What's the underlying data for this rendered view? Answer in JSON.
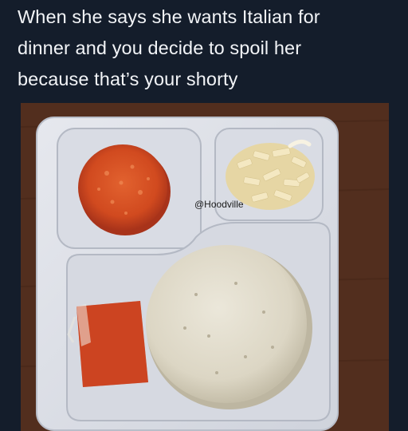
{
  "post": {
    "caption_lines": [
      "When she says she wants Italian for",
      "dinner and you decide to spoil her",
      "because that’s your shorty"
    ]
  },
  "photo": {
    "watermark": "@Hoodville",
    "colors": {
      "background": "#141d2b",
      "caption_text": "#f2f4f7",
      "table_wood": "#4a2a1c",
      "tray": "#dcdfe6",
      "pepperoni": "#d44a1e",
      "cheese": "#efe2b6",
      "sauce": "#c0391a",
      "crust": "#ddd8c8"
    }
  }
}
